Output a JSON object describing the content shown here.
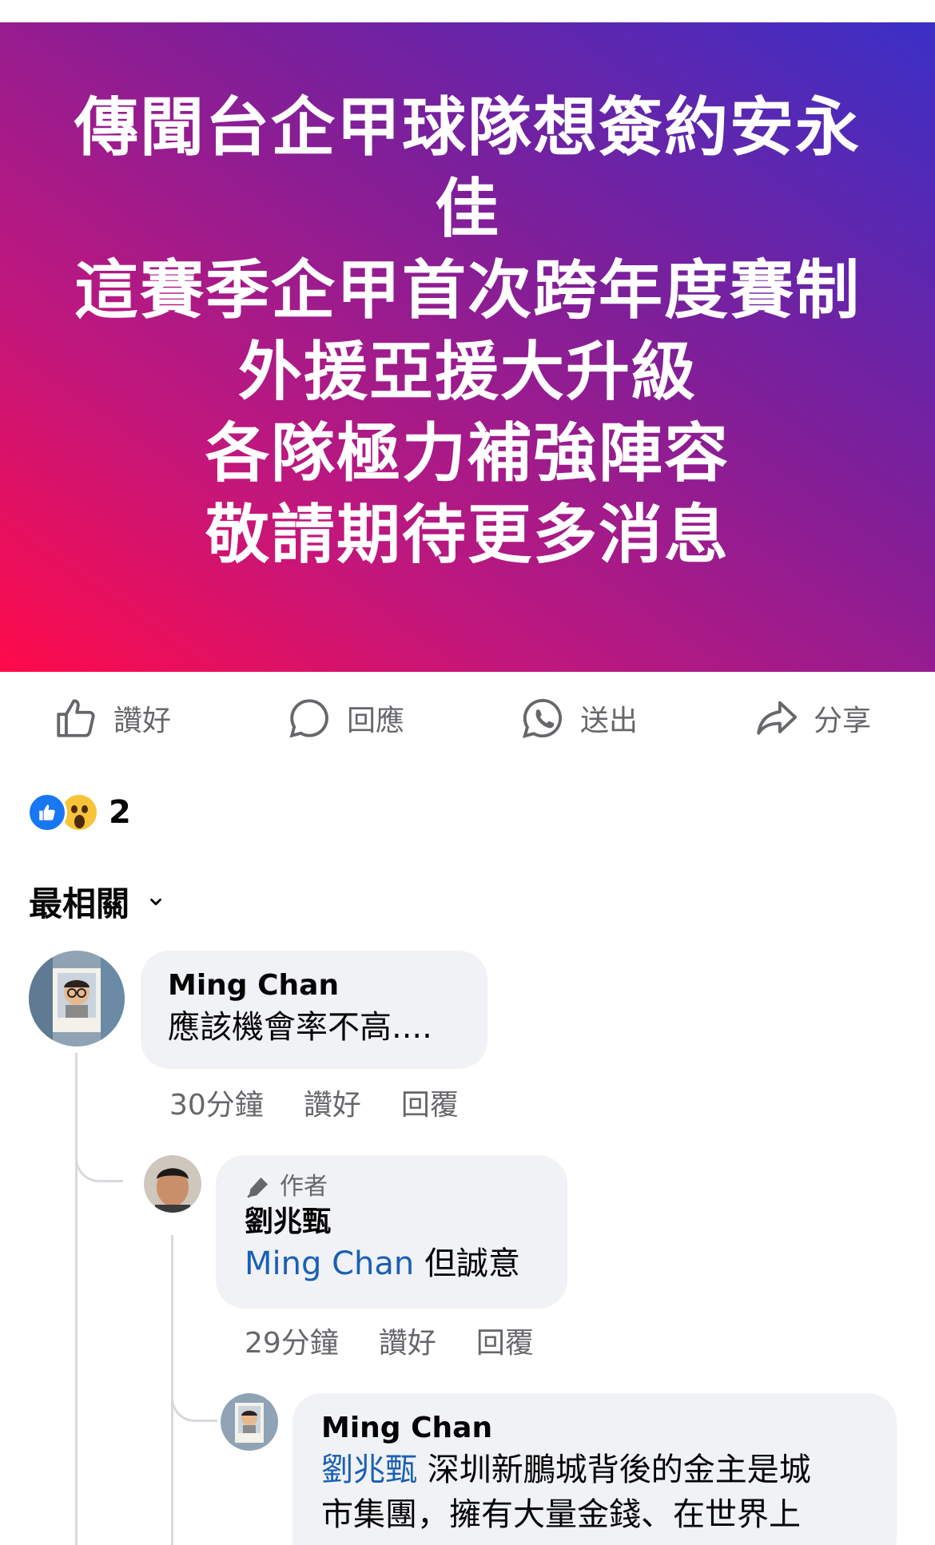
{
  "post": {
    "banner_lines": [
      "傳聞台企甲球隊想簽約安永",
      "佳",
      "這賽季企甲首次跨年度賽制",
      "外援亞援大升級",
      "各隊極力補強陣容",
      "敬請期待更多消息"
    ]
  },
  "actions": {
    "like": "讚好",
    "comment": "回應",
    "send": "送出",
    "share": "分享"
  },
  "reactions": {
    "count": "2",
    "icons": [
      "like-icon",
      "wow-icon"
    ]
  },
  "sort": {
    "label": "最相關"
  },
  "comments": [
    {
      "author": "Ming Chan",
      "text": "應該機會率不高....",
      "time": "30分鐘",
      "like": "讚好",
      "reply": "回覆"
    },
    {
      "author_badge": "作者",
      "author": "劉兆甄",
      "mention": "Ming Chan",
      "text": " 但誠意",
      "time": "29分鐘",
      "like": "讚好",
      "reply": "回覆"
    },
    {
      "author": "Ming Chan",
      "mention": "劉兆甄",
      "text_line1": " 深圳新鵬城背後的金主是城",
      "text_line2": "市集團，擁有大量金錢、在世界上"
    }
  ],
  "colors": {
    "like_blue": "#1877f2",
    "mention_blue": "#1a5fb4",
    "muted": "#65676b",
    "bubble": "#f0f2f5"
  }
}
